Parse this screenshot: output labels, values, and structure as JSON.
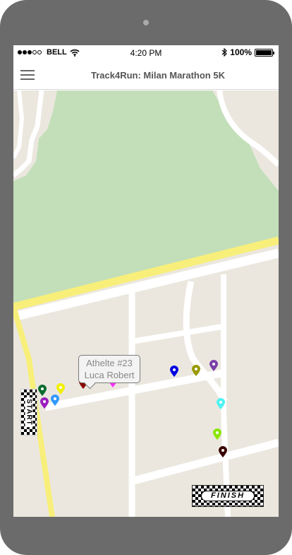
{
  "status_bar": {
    "carrier": "BELL",
    "time": "4:20 PM",
    "battery": "100%",
    "battery_level": 1.0,
    "signal_bars": 3,
    "signal_max": 5
  },
  "app_bar": {
    "title": "Track4Run: Milan Marathon 5K",
    "menu_icon": "hamburger-menu-icon"
  },
  "map": {
    "tooltip": {
      "line1": "Athelte #23",
      "line2": "Luca Robert"
    },
    "start_label": "START",
    "finish_label": "FINISH",
    "runner_colors": [
      "#0b6b2e",
      "#9b1fbf",
      "#3399ff",
      "#f2ef00",
      "#8b0000",
      "#ff33ff",
      "#000000",
      "#0000e0",
      "#999900",
      "#7a3fa8",
      "#4ef2f2",
      "#8ae600",
      "#3a0000"
    ]
  }
}
